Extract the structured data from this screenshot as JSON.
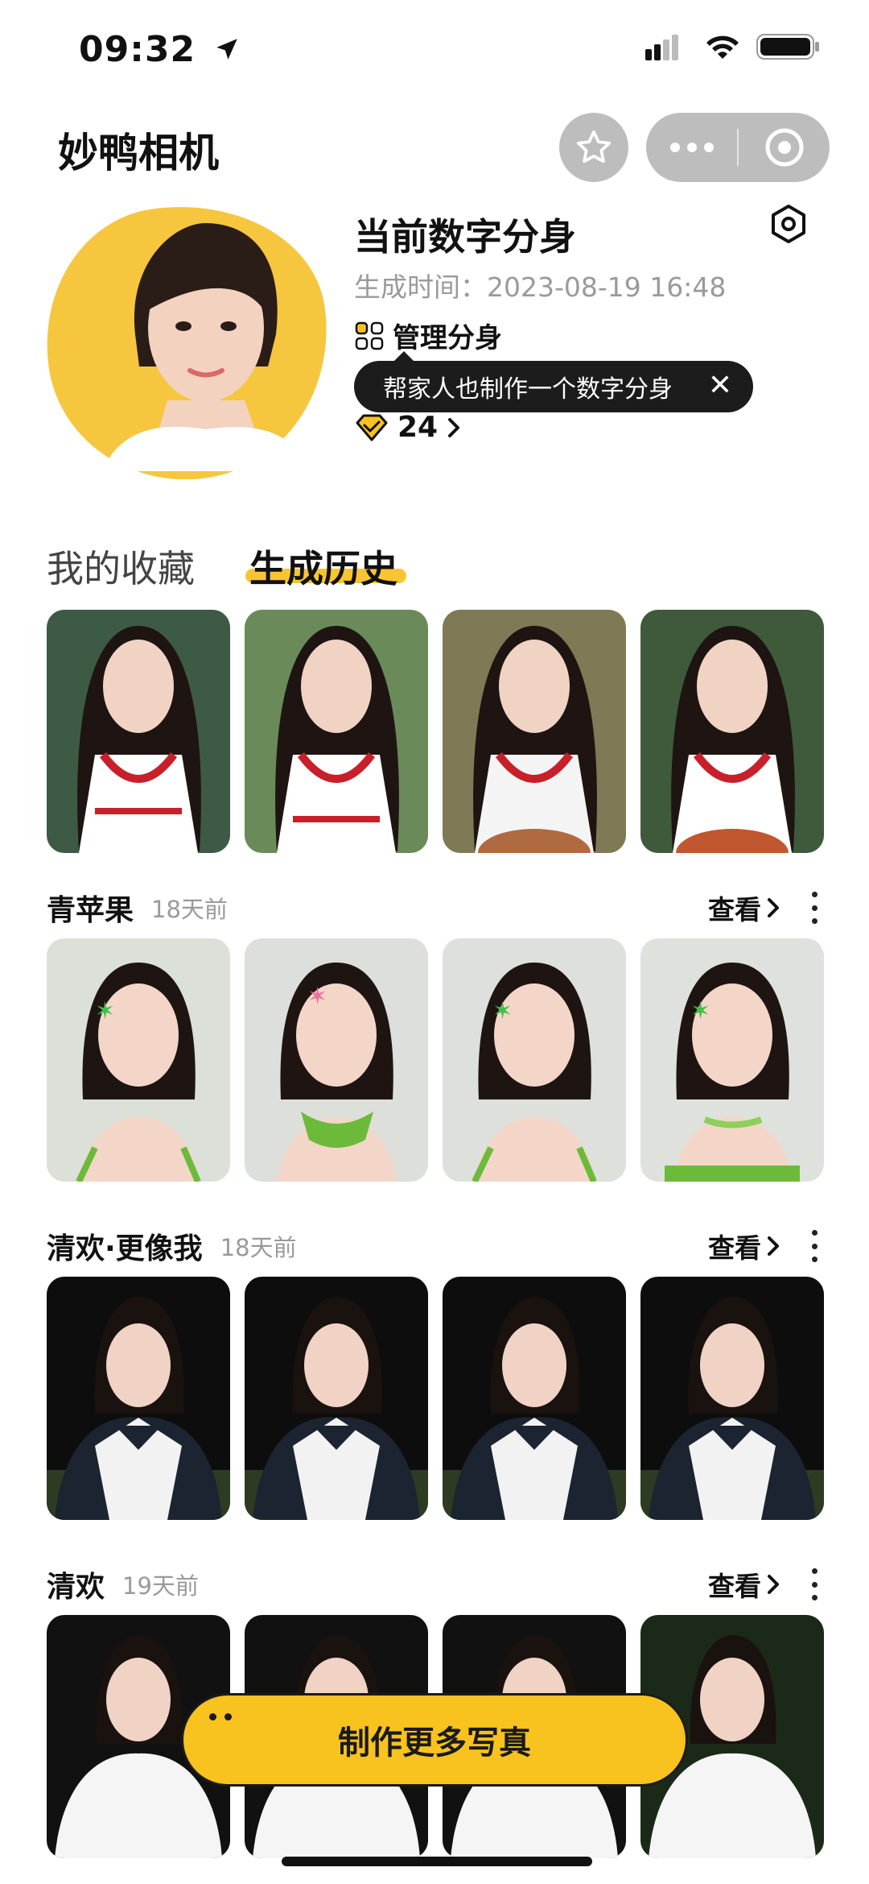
{
  "status_bar": {
    "time": "09:32"
  },
  "app": {
    "title": "妙鸭相机"
  },
  "profile": {
    "title": "当前数字分身",
    "generated_time": "生成时间：2023-08-19 16:48",
    "manage_label": "管理分身",
    "tooltip": "帮家人也制作一个数字分身",
    "credits": "24"
  },
  "tabs": [
    {
      "label": "我的收藏",
      "active": false
    },
    {
      "label": "生成历史",
      "active": true
    }
  ],
  "sections": [
    {
      "name": "青苹果",
      "time": "18天前",
      "view_label": "查看"
    },
    {
      "name": "清欢·更像我",
      "time": "18天前",
      "view_label": "查看"
    },
    {
      "name": "清欢",
      "time": "19天前",
      "view_label": "查看"
    }
  ],
  "cta": {
    "label": "制作更多写真"
  },
  "colors": {
    "accent": "#f8c21f",
    "avatar_bg": "#f6c63e",
    "muted": "#9a9a9a"
  }
}
